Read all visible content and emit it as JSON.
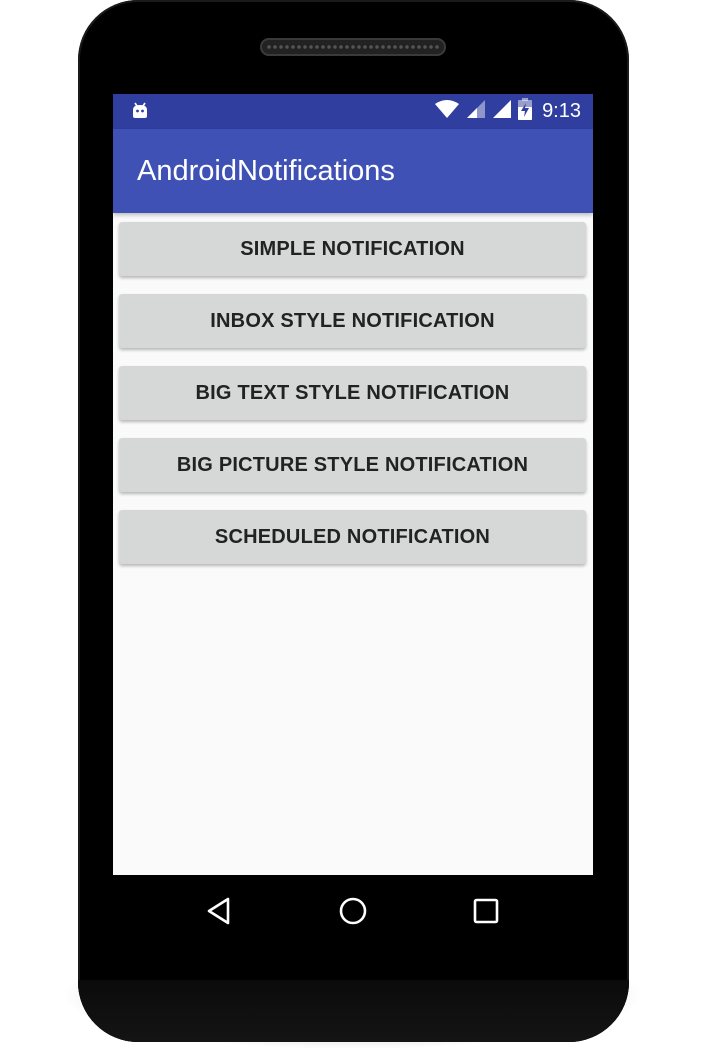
{
  "status_bar": {
    "time": "9:13",
    "icons": [
      "android-debug-icon",
      "wifi-icon",
      "cell-signal-icon",
      "cell-signal-icon",
      "battery-charging-icon"
    ]
  },
  "app_bar": {
    "title": "AndroidNotifications"
  },
  "buttons": [
    {
      "label": "SIMPLE NOTIFICATION"
    },
    {
      "label": "INBOX STYLE NOTIFICATION"
    },
    {
      "label": "BIG TEXT STYLE NOTIFICATION"
    },
    {
      "label": "BIG PICTURE STYLE NOTIFICATION"
    },
    {
      "label": "SCHEDULED NOTIFICATION"
    }
  ],
  "nav_bar": {
    "icons": [
      "back-icon",
      "home-icon",
      "recents-icon"
    ]
  },
  "colors": {
    "status_bar": "#303f9f",
    "app_bar": "#3f51b5",
    "button": "#d6d7d7",
    "screen_bg": "#fafafa"
  }
}
